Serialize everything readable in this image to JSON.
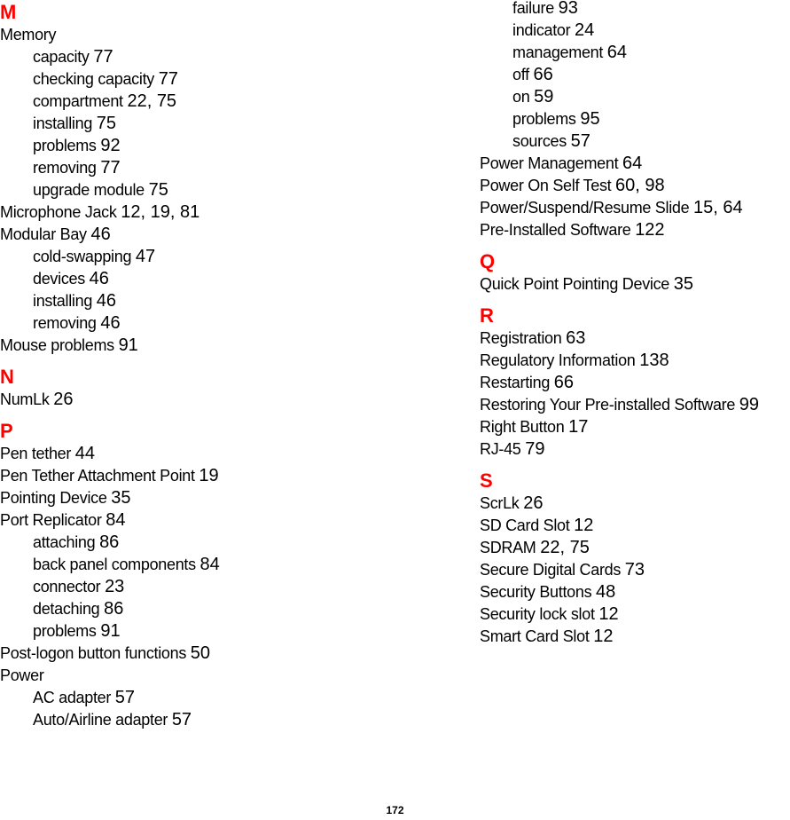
{
  "page_number": "172",
  "left_column": [
    {
      "type": "letter",
      "text": "M"
    },
    {
      "type": "entry",
      "level": 0,
      "term": "Memory",
      "pages": ""
    },
    {
      "type": "entry",
      "level": 1,
      "term": "capacity",
      "pages": "77"
    },
    {
      "type": "entry",
      "level": 1,
      "term": "checking capacity",
      "pages": "77"
    },
    {
      "type": "entry",
      "level": 1,
      "term": "compartment",
      "pages": "22, 75"
    },
    {
      "type": "entry",
      "level": 1,
      "term": "installing",
      "pages": "75"
    },
    {
      "type": "entry",
      "level": 1,
      "term": "problems",
      "pages": "92"
    },
    {
      "type": "entry",
      "level": 1,
      "term": "removing",
      "pages": "77"
    },
    {
      "type": "entry",
      "level": 1,
      "term": "upgrade module",
      "pages": "75"
    },
    {
      "type": "entry",
      "level": 0,
      "term": "Microphone Jack",
      "pages": "12, 19, 81"
    },
    {
      "type": "entry",
      "level": 0,
      "term": "Modular Bay",
      "pages": "46"
    },
    {
      "type": "entry",
      "level": 1,
      "term": "cold-swapping",
      "pages": "47"
    },
    {
      "type": "entry",
      "level": 1,
      "term": "devices",
      "pages": "46"
    },
    {
      "type": "entry",
      "level": 1,
      "term": "installing",
      "pages": "46"
    },
    {
      "type": "entry",
      "level": 1,
      "term": "removing",
      "pages": "46"
    },
    {
      "type": "entry",
      "level": 0,
      "term": "Mouse problems",
      "pages": "91"
    },
    {
      "type": "letter",
      "text": "N"
    },
    {
      "type": "entry",
      "level": 0,
      "term": "NumLk",
      "pages": "26"
    },
    {
      "type": "letter",
      "text": "P"
    },
    {
      "type": "entry",
      "level": 0,
      "term": "Pen tether",
      "pages": "44"
    },
    {
      "type": "entry",
      "level": 0,
      "term": "Pen Tether Attachment Point",
      "pages": "19"
    },
    {
      "type": "entry",
      "level": 0,
      "term": "Pointing Device",
      "pages": "35"
    },
    {
      "type": "entry",
      "level": 0,
      "term": "Port Replicator",
      "pages": "84"
    },
    {
      "type": "entry",
      "level": 1,
      "term": "attaching",
      "pages": "86"
    },
    {
      "type": "entry",
      "level": 1,
      "term": "back panel components",
      "pages": "84"
    },
    {
      "type": "entry",
      "level": 1,
      "term": "connector",
      "pages": "23"
    },
    {
      "type": "entry",
      "level": 1,
      "term": "detaching",
      "pages": "86"
    },
    {
      "type": "entry",
      "level": 1,
      "term": "problems",
      "pages": "91"
    },
    {
      "type": "entry",
      "level": 0,
      "term": "Post-logon button functions",
      "pages": "50"
    },
    {
      "type": "entry",
      "level": 0,
      "term": "Power",
      "pages": ""
    },
    {
      "type": "entry",
      "level": 1,
      "term": "AC adapter",
      "pages": "57"
    },
    {
      "type": "entry",
      "level": 1,
      "term": "Auto/Airline adapter",
      "pages": "57"
    }
  ],
  "right_column": [
    {
      "type": "entry",
      "level": 1,
      "term": "failure",
      "pages": "93"
    },
    {
      "type": "entry",
      "level": 1,
      "term": "indicator",
      "pages": "24"
    },
    {
      "type": "entry",
      "level": 1,
      "term": "management",
      "pages": "64"
    },
    {
      "type": "entry",
      "level": 1,
      "term": "off",
      "pages": "66"
    },
    {
      "type": "entry",
      "level": 1,
      "term": "on",
      "pages": "59"
    },
    {
      "type": "entry",
      "level": 1,
      "term": "problems",
      "pages": "95"
    },
    {
      "type": "entry",
      "level": 1,
      "term": "sources",
      "pages": "57"
    },
    {
      "type": "entry",
      "level": 0,
      "term": "Power Management",
      "pages": "64"
    },
    {
      "type": "entry",
      "level": 0,
      "term": "Power On Self Test",
      "pages": "60, 98"
    },
    {
      "type": "entry",
      "level": 0,
      "term": "Power/Suspend/Resume Slide",
      "pages": "15, 64"
    },
    {
      "type": "entry",
      "level": 0,
      "term": "Pre-Installed Software",
      "pages": "122"
    },
    {
      "type": "letter",
      "text": "Q"
    },
    {
      "type": "entry",
      "level": 0,
      "term": "Quick Point Pointing Device",
      "pages": "35"
    },
    {
      "type": "letter",
      "text": "R"
    },
    {
      "type": "entry",
      "level": 0,
      "term": "Registration",
      "pages": "63"
    },
    {
      "type": "entry",
      "level": 0,
      "term": "Regulatory Information",
      "pages": "138"
    },
    {
      "type": "entry",
      "level": 0,
      "term": "Restarting",
      "pages": "66"
    },
    {
      "type": "entry",
      "level": 0,
      "term": "Restoring Your Pre-installed Software",
      "pages": "99"
    },
    {
      "type": "entry",
      "level": 0,
      "term": "Right Button",
      "pages": "17"
    },
    {
      "type": "entry",
      "level": 0,
      "term": "RJ-45",
      "pages": "79"
    },
    {
      "type": "letter",
      "text": "S"
    },
    {
      "type": "entry",
      "level": 0,
      "term": "ScrLk",
      "pages": "26"
    },
    {
      "type": "entry",
      "level": 0,
      "term": "SD Card Slot",
      "pages": "12"
    },
    {
      "type": "entry",
      "level": 0,
      "term": "SDRAM",
      "pages": "22, 75"
    },
    {
      "type": "entry",
      "level": 0,
      "term": "Secure Digital Cards",
      "pages": "73"
    },
    {
      "type": "entry",
      "level": 0,
      "term": "Security Buttons",
      "pages": "48"
    },
    {
      "type": "entry",
      "level": 0,
      "term": "Security lock slot",
      "pages": "12"
    },
    {
      "type": "entry",
      "level": 0,
      "term": "Smart Card Slot",
      "pages": "12"
    }
  ],
  "colors": {
    "section_letter": "#ff0000",
    "text": "#000000"
  }
}
